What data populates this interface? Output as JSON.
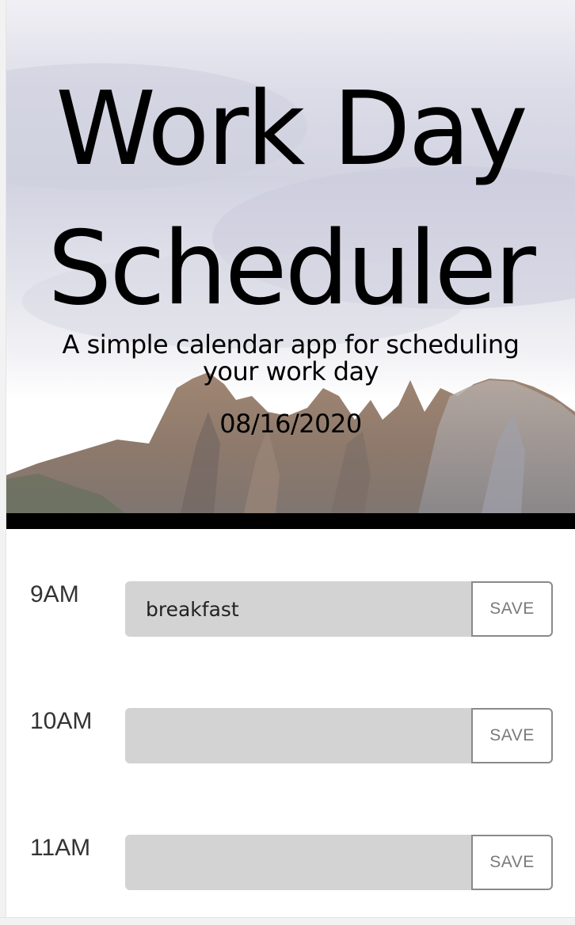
{
  "header": {
    "title": "Work Day Scheduler",
    "lead": "A simple calendar app for scheduling your work day",
    "current_date": "08/16/2020"
  },
  "timeblocks": [
    {
      "hour": "9AM",
      "value": "breakfast",
      "save_label": "SAVE"
    },
    {
      "hour": "10AM",
      "value": "",
      "save_label": "SAVE"
    },
    {
      "hour": "11AM",
      "value": "",
      "save_label": "SAVE"
    }
  ],
  "colors": {
    "textarea_bg": "#d3d3d3",
    "header_rule": "#000000",
    "save_border": "#8a8a8a"
  }
}
